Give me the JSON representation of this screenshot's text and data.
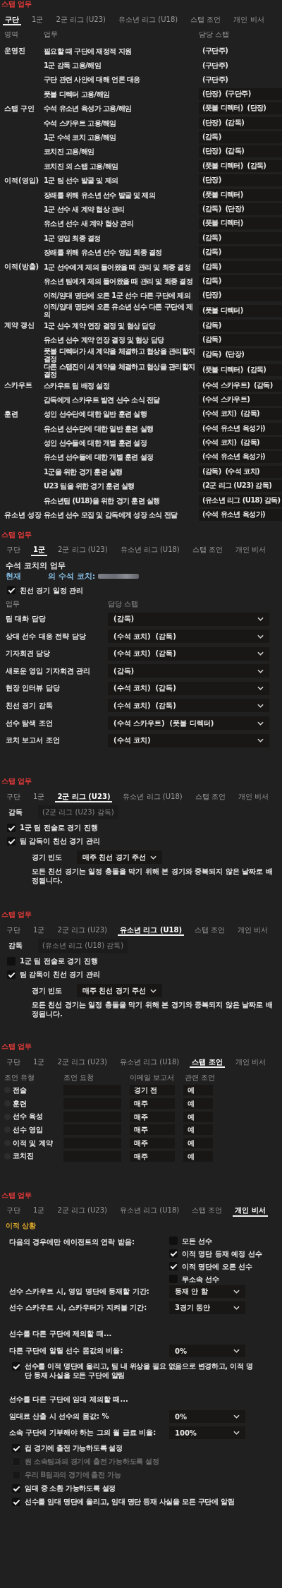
{
  "panels": [
    {
      "kind": "club_duties",
      "label": "스탭 업무",
      "tabs": [
        {
          "label": "구단",
          "selected": true
        },
        {
          "label": "1군",
          "selected": false
        },
        {
          "label": "2군 리그 (U23)",
          "selected": false
        },
        {
          "label": "유소년 리그 (U18)",
          "selected": false
        },
        {
          "label": "스탭 조언",
          "selected": false
        },
        {
          "label": "개인 비서",
          "selected": false
        }
      ],
      "columns": [
        "영역",
        "업무",
        "담당 스탭"
      ],
      "groups": [
        {
          "area": "운영진",
          "tasks": [
            {
              "task": "필요할 때 구단에 재정적 지원",
              "staff": "(구단주)",
              "editable": false
            },
            {
              "task": "1군 감독 고용/해임",
              "staff": "(구단주)",
              "editable": false
            },
            {
              "task": "구단 관련 사안에 대해 언론 대응",
              "staff": "(구단주)",
              "editable": false
            },
            {
              "task": "풋볼 디렉터 고용/해임",
              "staff": "(단장)  (구단주)",
              "editable": true
            }
          ]
        },
        {
          "area": "스탭 구인",
          "tasks": [
            {
              "task": "수석 유소년 육성가 고용/해임",
              "staff": "(풋볼 디렉터)  (단장)",
              "editable": true
            },
            {
              "task": "수석 스카우트 고용/해임",
              "staff": "(단장)  (감독)",
              "editable": true
            },
            {
              "task": "1군 수석 코치 고용/해임",
              "staff": "(감독)",
              "editable": true
            },
            {
              "task": "코치진 고용/해임",
              "staff": "(단장)  (감독)",
              "editable": true
            },
            {
              "task": "코치진 외 스탭 고용/해임",
              "staff": "(풋볼 디렉터)  (감독)",
              "editable": true
            }
          ]
        },
        {
          "area": "이적(영입)",
          "tasks": [
            {
              "task": "1군 팀 선수 발굴 및 제의",
              "staff": "(단장)",
              "editable": true
            },
            {
              "task": "장래를 위해 유소년 선수 발굴 및 제의",
              "staff": "(풋볼 디렉터)",
              "editable": true
            },
            {
              "task": "1군 선수 새 계약 협상 관리",
              "staff": "(감독)  (단장)",
              "editable": true
            },
            {
              "task": "유소년 선수 새 계약 협상 관리",
              "staff": "(풋볼 디렉터)",
              "editable": true
            },
            {
              "task": "1군 영입 최종 결정",
              "staff": "(감독)",
              "editable": true
            },
            {
              "task": "장래를 위해 유소년 선수 영입 최종 결정",
              "staff": "(감독)",
              "editable": true
            }
          ]
        },
        {
          "area": "이적(방출)",
          "tasks": [
            {
              "task": "1군 선수에게 제의 들어왔을 때 관리 및 최종 결정",
              "staff": "(감독)",
              "editable": true
            },
            {
              "task": "유소년 팀에게 제의 들어왔을 때 관리 및 최종 결정",
              "staff": "(감독)",
              "editable": true
            },
            {
              "task": "이적/임대 명단에 오른 1군 선수 다른 구단에 제의",
              "staff": "(단장)",
              "editable": true
            },
            {
              "task": "이적/임대 명단에 오른 유소년 선수 다른 구단에 제의",
              "staff": "(풋볼 디렉터)",
              "editable": true
            }
          ]
        },
        {
          "area": "계약 갱신",
          "tasks": [
            {
              "task": "1군 선수 계약 연장 결정 및 협상 담당",
              "staff": "(감독)",
              "editable": true
            },
            {
              "task": "유소년 선수 계약 연장 결정 및 협상 담당",
              "staff": "(감독)",
              "editable": true
            },
            {
              "task": "풋볼 디렉터가 새 계약을 체결하고 협상을 관리할지 결정",
              "staff": "(감독)  (단장)",
              "editable": true
            },
            {
              "task": "다른 스탭진이 새 계약을 체결하고 협상을 관리할지 결정",
              "staff": "(풋볼 디렉터)  (감독)",
              "editable": true
            }
          ]
        },
        {
          "area": "스카우트",
          "tasks": [
            {
              "task": "스카우트 팀 배정 설정",
              "staff": "(수석 스카우트)  (감독)",
              "editable": true
            },
            {
              "task": "감독에게 스카우트 발견 선수 소식 전달",
              "staff": "(수석 스카우트)",
              "editable": true
            }
          ]
        },
        {
          "area": "훈련",
          "tasks": [
            {
              "task": "성인 선수단에 대한 일반 훈련 실행",
              "staff": "(수석 코치)  (감독)",
              "editable": true
            },
            {
              "task": "유소년 선수단에 대한 일반 훈련 실행",
              "staff": "(수석 유소년 육성가)",
              "editable": true
            },
            {
              "task": "성인 선수들에 대한 개별 훈련 설정",
              "staff": "(수석 코치)  (감독)",
              "editable": true
            },
            {
              "task": "유소년 선수들에 대한 개별 훈련 설정",
              "staff": "(수석 유소년 육성가)",
              "editable": true
            },
            {
              "task": "1군을 위한 경기 훈련 실행",
              "staff": "(감독)  (수석 코치)",
              "editable": true
            },
            {
              "task": "U23 팀을 위한 경기 훈련 실행",
              "staff": "(2군 리그 (U23) 감독)",
              "editable": true
            },
            {
              "task": "유소년팀 (U18)을 위한 경기 훈련 실행",
              "staff": "(유소년 리그 (U18) 감독)",
              "editable": true
            }
          ]
        },
        {
          "area": "유소년 성장",
          "tasks": [
            {
              "task": "유소년 선수 모집 및 감독에게 성장 소식 전달",
              "staff": "(수석 유소년 육성가)",
              "editable": true
            }
          ]
        }
      ]
    },
    {
      "kind": "coach_duties",
      "label": "스탭 업무",
      "tabs": [
        {
          "label": "구단",
          "selected": false
        },
        {
          "label": "1군",
          "selected": true
        },
        {
          "label": "2군 리그 (U23)",
          "selected": false
        },
        {
          "label": "유소년 리그 (U18)",
          "selected": false
        },
        {
          "label": "스탭 조언",
          "selected": false
        },
        {
          "label": "개인 비서",
          "selected": false
        }
      ],
      "heading": "수석 코치의 업무",
      "current": {
        "prefix": "현재",
        "suffix": "의 수석 코치:",
        "redacted": true
      },
      "options": [
        {
          "label": "친선 경기 일정 관리",
          "checked": true
        }
      ],
      "columns": [
        "업무",
        "담당 스탭"
      ],
      "duties": [
        {
          "task": "팀 대화 담당",
          "staff": "(감독)"
        },
        {
          "task": "상대 선수 대응 전략 담당",
          "staff": "(수석 코치)  (감독)"
        },
        {
          "task": "기자회견 담당",
          "staff": "(수석 코치)  (감독)"
        },
        {
          "task": "새로운 영입 기자회견 관리",
          "staff": "(감독)"
        },
        {
          "task": "현장 인터뷰 담당",
          "staff": "(수석 코치)  (감독)"
        },
        {
          "task": "친선 경기 감독",
          "staff": "(수석 코치)  (감독)"
        },
        {
          "task": "선수 탐색 조언",
          "staff": "(수석 스카우트)  (풋볼 디렉터)"
        },
        {
          "task": "코치 보고서 조언",
          "staff": "(수석 코치)"
        }
      ]
    },
    {
      "kind": "team_manager",
      "label": "스탭 업무",
      "tabs": [
        {
          "label": "구단",
          "selected": false
        },
        {
          "label": "1군",
          "selected": false
        },
        {
          "label": "2군 리그 (U23)",
          "selected": true
        },
        {
          "label": "유소년 리그 (U18)",
          "selected": false
        },
        {
          "label": "스탭 조언",
          "selected": false
        },
        {
          "label": "개인 비서",
          "selected": false
        }
      ],
      "manager": {
        "label": "감독",
        "value": "(2군 리그 (U23) 감독)"
      },
      "options": [
        {
          "label": "1군 팀 전술로 경기 진행",
          "checked": true
        },
        {
          "label": "팀 감독이 친선 경기 관리",
          "checked": true
        }
      ],
      "frequency": {
        "label": "경기 빈도",
        "value": "매주 친선 경기 주선"
      },
      "note": "모든 친선 경기는 일정 충돌을 막기 위해 본 경기와 중복되지 않은 날짜로 배정됩니다."
    },
    {
      "kind": "team_manager",
      "label": "스탭 업무",
      "tabs": [
        {
          "label": "구단",
          "selected": false
        },
        {
          "label": "1군",
          "selected": false
        },
        {
          "label": "2군 리그 (U23)",
          "selected": false
        },
        {
          "label": "유소년 리그 (U18)",
          "selected": true
        },
        {
          "label": "스탭 조언",
          "selected": false
        },
        {
          "label": "개인 비서",
          "selected": false
        }
      ],
      "manager": {
        "label": "감독",
        "value": "(유소년 리그 (U18) 감독)"
      },
      "options": [
        {
          "label": "1군 팀 전술로 경기 진행",
          "checked": false
        },
        {
          "label": "팀 감독이 친선 경기 관리",
          "checked": true
        }
      ],
      "frequency": {
        "label": "경기 빈도",
        "value": "매주 친선 경기 주선"
      },
      "note": "모든 친선 경기는 일정 충돌을 막기 위해 본 경기와 중복되지 않은 날짜로 배정됩니다."
    },
    {
      "kind": "advice",
      "label": "스탭 업무",
      "tabs": [
        {
          "label": "구단",
          "selected": false
        },
        {
          "label": "1군",
          "selected": false
        },
        {
          "label": "2군 리그 (U23)",
          "selected": false
        },
        {
          "label": "유소년 리그 (U18)",
          "selected": false
        },
        {
          "label": "스탭 조언",
          "selected": true
        },
        {
          "label": "개인 비서",
          "selected": false
        }
      ],
      "columns": [
        "조언 유형",
        "조언 요청",
        "이메일 보고서",
        "관련 조언"
      ],
      "rows": [
        {
          "type": "전술",
          "selected": false,
          "email": "경기 전",
          "related": "예"
        },
        {
          "type": "훈련",
          "selected": false,
          "email": "매주",
          "related": "예"
        },
        {
          "type": "선수 육성",
          "selected": false,
          "email": "매주",
          "related": "예"
        },
        {
          "type": "선수 영입",
          "selected": false,
          "email": "매주",
          "related": "예"
        },
        {
          "type": "이적 및 계약",
          "selected": false,
          "email": "매주",
          "related": "예"
        },
        {
          "type": "코치진",
          "selected": false,
          "email": "매주",
          "related": "예"
        }
      ]
    },
    {
      "kind": "assistant",
      "label": "스탭 업무",
      "tabs": [
        {
          "label": "구단",
          "selected": false
        },
        {
          "label": "1군",
          "selected": false
        },
        {
          "label": "2군 리그 (U23)",
          "selected": false
        },
        {
          "label": "유소년 리그 (U18)",
          "selected": false
        },
        {
          "label": "스탭 조언",
          "selected": false
        },
        {
          "label": "개인 비서",
          "selected": true
        }
      ],
      "section_title": "이적 상황",
      "items": [
        {
          "kind": "checklist",
          "label": "다음의 경우에만 에이전트의 연락 받음:",
          "options": [
            {
              "label": "모든 선수",
              "checked": false
            },
            {
              "label": "이적 명단 등재 예정 선수",
              "checked": true
            },
            {
              "label": "이적 명단에 오른 선수",
              "checked": true
            },
            {
              "label": "무소속 선수",
              "checked": false
            }
          ]
        },
        {
          "kind": "select",
          "label": "선수 스카우트 시, 영입 명단에 등재할 기간:",
          "value": "등재 안 함"
        },
        {
          "kind": "select",
          "label": "선수 스카우트 시, 스카우터가 지켜볼 기간:",
          "value": "3경기 동안"
        },
        {
          "kind": "heading",
          "text": "선수를 다른 구단에 제의할 때..."
        },
        {
          "kind": "select",
          "label": "다른 구단에 알릴 선수 몸값의 비율:",
          "value": "0%"
        },
        {
          "kind": "check",
          "label": "선수를 이적 명단에 올리고, 팀 내 위상을 필요 없음으로 변경하고, 이적 명단 등재 사실을 모든 구단에 알림",
          "checked": true,
          "disabled": false
        },
        {
          "kind": "heading",
          "text": "선수를 다른 구단에 임대 제의할 때..."
        },
        {
          "kind": "select",
          "label": "임대료 산출 시 선수의 몸값: %",
          "value": "0%"
        },
        {
          "kind": "select",
          "label": "소속 구단에 기부해야 하는 그의 월 급료 비율:",
          "value": "100%"
        },
        {
          "kind": "check",
          "label": "컵 경기에 출전 가능하도록 설정",
          "checked": true,
          "disabled": false
        },
        {
          "kind": "check",
          "label": "원 소속팀과의 경기에 출전 가능하도록 설정",
          "checked": false,
          "disabled": true
        },
        {
          "kind": "check",
          "label": "우리 B팀과의 경기에 출전 가능",
          "checked": false,
          "disabled": true
        },
        {
          "kind": "check",
          "label": "임대 중 소환 가능하도록 설정",
          "checked": true,
          "disabled": false
        },
        {
          "kind": "check",
          "label": "선수를 임대 명단에 올리고, 임대 명단 등재 사실을 모든 구단에 알림",
          "checked": true,
          "disabled": false
        }
      ]
    }
  ]
}
